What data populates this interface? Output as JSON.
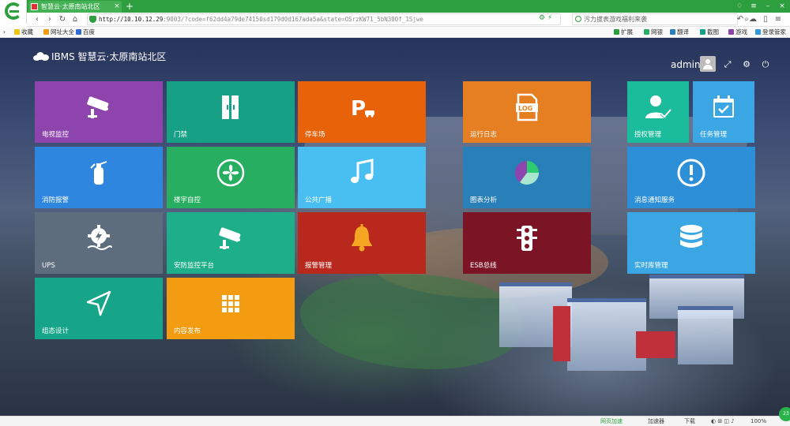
{
  "browser": {
    "tab_title": "智慧云·太原南站北区",
    "tab_close": "×",
    "new_tab": "+",
    "url_host": "http://10.10.12.29",
    "url_rest": ":9003/?code=f62dd4a79de74150sd179d0d167ada5a&state=OSrzKW71_5bN300f_1Sjwe",
    "search_text": "污力拔表游戏福利来袭",
    "bookmarks": [
      "收藏",
      "网址大全",
      "百度"
    ],
    "toolbar_right": [
      "扩展",
      "网银",
      "翻译",
      "截图",
      "游戏",
      "登录管家"
    ],
    "status_items": [
      "网页加速",
      "加速器",
      "下载",
      "100%"
    ],
    "speed_badge": "23"
  },
  "header": {
    "brand": "IBMS 智慧云·太原南站北区",
    "user": "admin"
  },
  "tiles": [
    {
      "label": "电视监控",
      "color": "#8e44ad",
      "icon": "cctv-camera-icon"
    },
    {
      "label": "门禁",
      "color": "#16a085",
      "icon": "door-access-icon"
    },
    {
      "label": "停车场",
      "color": "#e8620a",
      "icon": "parking-icon"
    },
    {
      "label": "运行日志",
      "color": "#e67e22",
      "icon": "log-file-icon"
    },
    {
      "label": "授权管理",
      "color": "#1abc9c",
      "icon": "user-check-icon"
    },
    {
      "label": "任务管理",
      "color": "#3aa7e4",
      "icon": "calendar-check-icon"
    },
    {
      "label": "消防报警",
      "color": "#2e86de",
      "icon": "fire-extinguisher-icon"
    },
    {
      "label": "楼宇自控",
      "color": "#27ae60",
      "icon": "fan-icon"
    },
    {
      "label": "公共广播",
      "color": "#48bff0",
      "icon": "music-note-icon"
    },
    {
      "label": "图表分析",
      "color": "#2980b9",
      "icon": "pie-chart-icon"
    },
    {
      "label": "消息通知服务",
      "color": "#2d8fd8",
      "icon": "alert-circle-icon"
    },
    {
      "label": "UPS",
      "color": "#5d6d7e",
      "icon": "ups-gear-icon"
    },
    {
      "label": "安防监控平台",
      "color": "#1fae8a",
      "icon": "security-camera-icon"
    },
    {
      "label": "报警管理",
      "color": "#b8281d",
      "icon": "bell-icon"
    },
    {
      "label": "ESB总线",
      "color": "#7b1526",
      "icon": "traffic-light-icon"
    },
    {
      "label": "实时库管理",
      "color": "#3aa7e4",
      "icon": "database-icon"
    },
    {
      "label": "组态设计",
      "color": "#17a589",
      "icon": "navigation-arrow-icon"
    },
    {
      "label": "内容发布",
      "color": "#f39c12",
      "icon": "grid-apps-icon"
    }
  ]
}
